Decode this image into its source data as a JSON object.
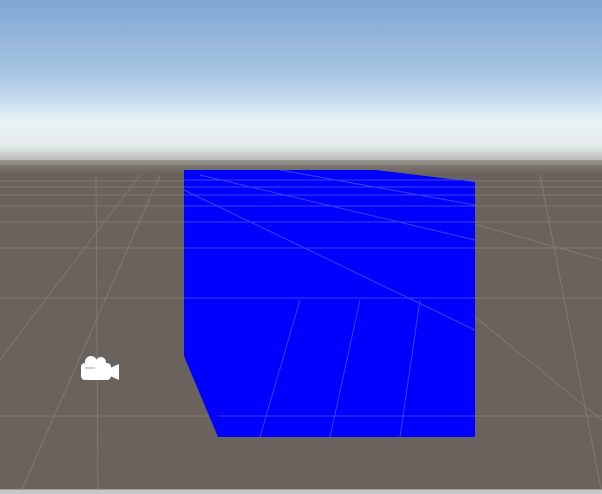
{
  "scene_view": {
    "skybox": {
      "top_color": "#7fa6d1",
      "horizon_color": "#e8f3f6",
      "haze_color": "#c8ccc8"
    },
    "ground_color": "#6a625c",
    "grid_color": "#8a8581",
    "selected_object": {
      "type": "cube",
      "material_color": "#0000ff"
    },
    "gizmos": [
      {
        "name": "camera-icon",
        "color": "#ffffff"
      }
    ]
  }
}
